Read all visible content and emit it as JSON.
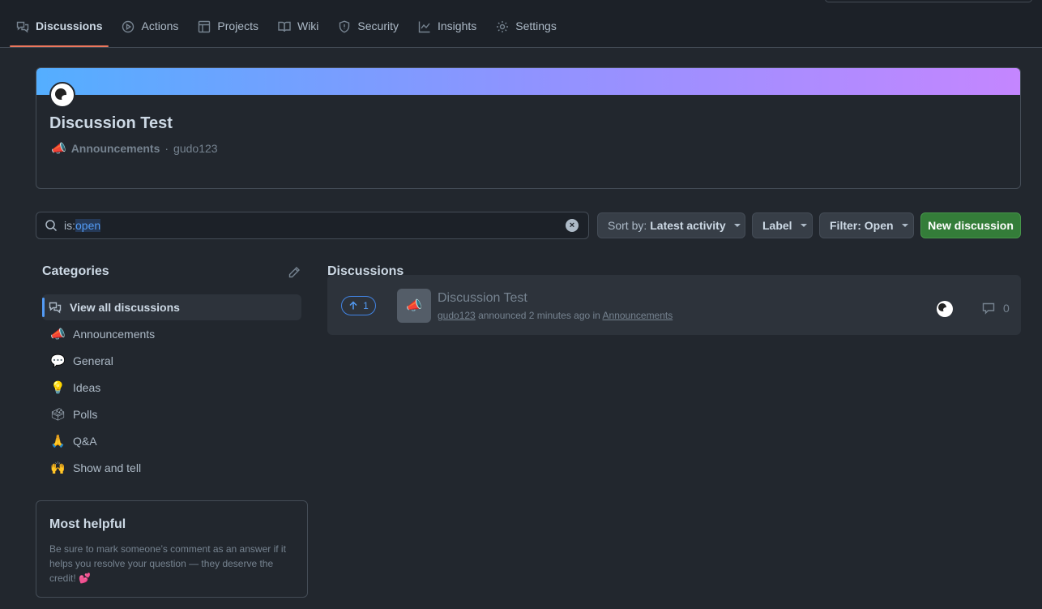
{
  "nav": {
    "tabs": [
      {
        "label": "Discussions",
        "icon": "comment-discussion-icon"
      },
      {
        "label": "Actions",
        "icon": "play-icon"
      },
      {
        "label": "Projects",
        "icon": "table-icon"
      },
      {
        "label": "Wiki",
        "icon": "book-icon"
      },
      {
        "label": "Security",
        "icon": "shield-icon"
      },
      {
        "label": "Insights",
        "icon": "graph-icon"
      },
      {
        "label": "Settings",
        "icon": "gear-icon"
      }
    ],
    "active_tab": "Discussions",
    "active_color": "#ec775c"
  },
  "header": {
    "title": "Discussion Test",
    "category": "Announcements",
    "category_emoji": "📣",
    "separator": "·",
    "author": "gudo123"
  },
  "filters": {
    "search_prefix": "is:",
    "search_value": "open",
    "sort_prefix": "Sort by:",
    "sort_value": "Latest activity",
    "label_button": "Label",
    "filter_button": "Filter: Open",
    "new_button": "New discussion"
  },
  "categories": {
    "heading": "Categories",
    "items": [
      {
        "label": "View all discussions",
        "emoji": "💬",
        "icon": "comment-discussion-icon"
      },
      {
        "label": "Announcements",
        "emoji": "📣"
      },
      {
        "label": "General",
        "emoji": "💬"
      },
      {
        "label": "Ideas",
        "emoji": "💡"
      },
      {
        "label": "Polls",
        "emoji": "🗳"
      },
      {
        "label": "Q&A",
        "emoji": "🙏"
      },
      {
        "label": "Show and tell",
        "emoji": "🙌"
      }
    ]
  },
  "helpful": {
    "heading": "Most helpful",
    "body": "Be sure to mark someone’s comment as an answer if it helps you resolve your question — they deserve the credit!",
    "emoji": "💕"
  },
  "discussions": {
    "heading": "Discussions",
    "items": [
      {
        "votes": "1",
        "title": "Discussion Test",
        "author": "gudo123",
        "action": "announced 2 minutes ago in",
        "category": "Announcements",
        "comments": "0"
      }
    ]
  },
  "colors": {
    "background": "#22272e",
    "primary_button": "#347d39",
    "accent_blue": "#539bf5"
  }
}
